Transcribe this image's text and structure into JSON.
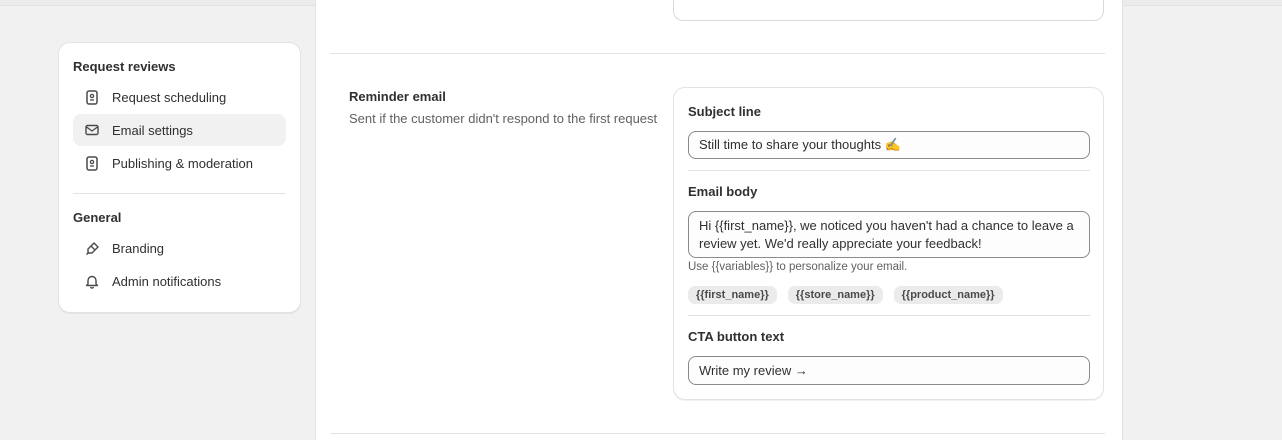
{
  "sidebar": {
    "request_reviews_heading": "Request reviews",
    "items": [
      {
        "label": "Request scheduling",
        "icon": "receipt-icon"
      },
      {
        "label": "Email settings",
        "icon": "mail-icon",
        "active": true
      },
      {
        "label": "Publishing & moderation",
        "icon": "receipt-icon"
      }
    ],
    "general_heading": "General",
    "general_items": [
      {
        "label": "Branding",
        "icon": "paint-brush-icon"
      },
      {
        "label": "Admin notifications",
        "icon": "bell-icon"
      }
    ]
  },
  "reminder": {
    "title": "Reminder email",
    "description": "Sent if the customer didn't respond to the first request",
    "subject_label": "Subject line",
    "subject_value": "Still time to share your thoughts ✍️",
    "body_label": "Email body",
    "body_value": "Hi {{first_name}}, we noticed you haven't had a chance to leave a review yet. We'd really appreciate your feedback!",
    "help_text": "Use {{variables}} to personalize your email.",
    "variables": [
      "{{first_name}}",
      "{{store_name}}",
      "{{product_name}}"
    ],
    "cta_label": "CTA button text",
    "cta_value": "Write my review →"
  },
  "colors": {
    "page_bg": "#f1f1f1",
    "card_bg": "#ffffff",
    "text": "#303030",
    "muted_text": "#616161",
    "active_item_bg": "#f1f1f1"
  }
}
